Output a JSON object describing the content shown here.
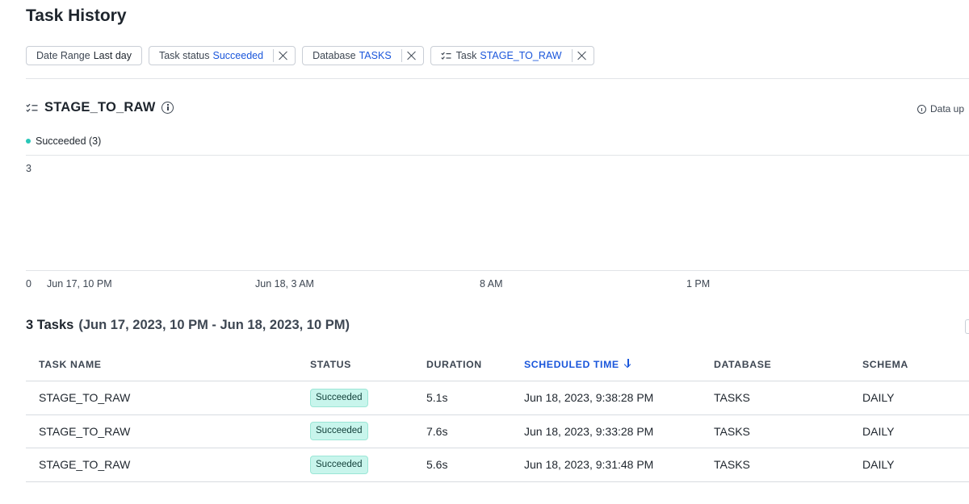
{
  "page": {
    "title": "Task History"
  },
  "filters": [
    {
      "label": "Date Range",
      "value": "Last day",
      "removable": false
    },
    {
      "label": "Task status",
      "value": "Succeeded",
      "removable": true
    },
    {
      "label": "Database",
      "value": "TASKS",
      "removable": true
    },
    {
      "label": "Task",
      "value": "STAGE_TO_RAW",
      "removable": true,
      "icon": "task-icon"
    }
  ],
  "task": {
    "name": "STAGE_TO_RAW",
    "data_updated_label": "Data up"
  },
  "chart_data": {
    "type": "bar",
    "series": [
      {
        "name": "Succeeded (3)",
        "color": "#29c7b8",
        "values": []
      }
    ],
    "legend": "top-left",
    "yticks": [
      "3",
      "0"
    ],
    "ylim": [
      0,
      3
    ],
    "xticks": [
      "Jun 17, 10 PM",
      "Jun 18, 3 AM",
      "8 AM",
      "1 PM"
    ],
    "grid": true
  },
  "tasks_table": {
    "count_label": "3 Tasks",
    "range_label": "(Jun 17, 2023, 10 PM - Jun 18, 2023, 10 PM)",
    "columns": [
      "TASK NAME",
      "STATUS",
      "DURATION",
      "SCHEDULED TIME",
      "DATABASE",
      "SCHEMA"
    ],
    "sorted_column": "SCHEDULED TIME",
    "status_color": "#c8f5ec",
    "rows": [
      {
        "task_name": "STAGE_TO_RAW",
        "status": "Succeeded",
        "duration": "5.1s",
        "scheduled_time": "Jun 18, 2023, 9:38:28 PM",
        "database": "TASKS",
        "schema": "DAILY"
      },
      {
        "task_name": "STAGE_TO_RAW",
        "status": "Succeeded",
        "duration": "7.6s",
        "scheduled_time": "Jun 18, 2023, 9:33:28 PM",
        "database": "TASKS",
        "schema": "DAILY"
      },
      {
        "task_name": "STAGE_TO_RAW",
        "status": "Succeeded",
        "duration": "5.6s",
        "scheduled_time": "Jun 18, 2023, 9:31:48 PM",
        "database": "TASKS",
        "schema": "DAILY"
      }
    ]
  }
}
